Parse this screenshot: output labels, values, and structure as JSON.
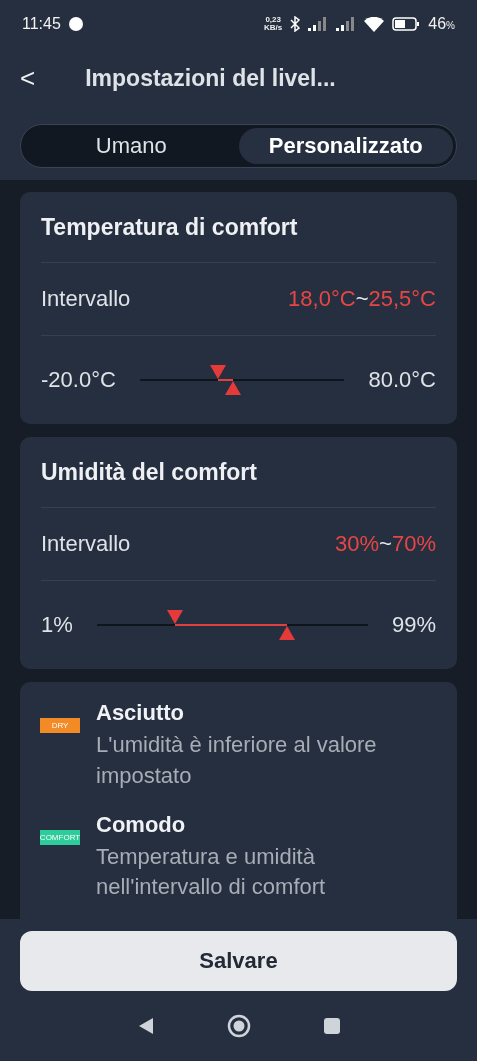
{
  "status_bar": {
    "time": "11:45",
    "speed": "0,23",
    "speed_unit": "KB/s",
    "battery": "46",
    "battery_unit": "%"
  },
  "header": {
    "back": "<",
    "title": "Impostazioni del livel..."
  },
  "tabs": [
    {
      "label": "Umano",
      "selected": false
    },
    {
      "label": "Personalizzato",
      "selected": true
    }
  ],
  "cards": [
    {
      "title": "Temperatura di comfort",
      "range_label": "Intervallo",
      "range_low": "18,0°C",
      "range_sep": "~",
      "range_high": "25,5°C",
      "min_label": "-20.0°C",
      "max_label": "80.0°C",
      "thumbs": [
        {
          "level": 0.38
        },
        {
          "level": 0.455
        }
      ]
    },
    {
      "title": "Umidità del comfort",
      "range_label": "Intervallo",
      "range_low": "30%",
      "range_sep": "~",
      "range_high": "70%",
      "min_label": "1%",
      "max_label": "99%",
      "thumbs": [
        {
          "level": 0.29
        },
        {
          "level": 0.7
        }
      ]
    }
  ],
  "legend": [
    {
      "tag": "DRY",
      "color": "#f28b25",
      "title": "Asciutto",
      "description": "L'umidità è inferiore al valore impostato"
    },
    {
      "tag": "COMFORT",
      "color": "#2ecc9a",
      "title": "Comodo",
      "description": "Temperatura e umidità nell'intervallo di comfort"
    }
  ],
  "save_button": "Salvare"
}
